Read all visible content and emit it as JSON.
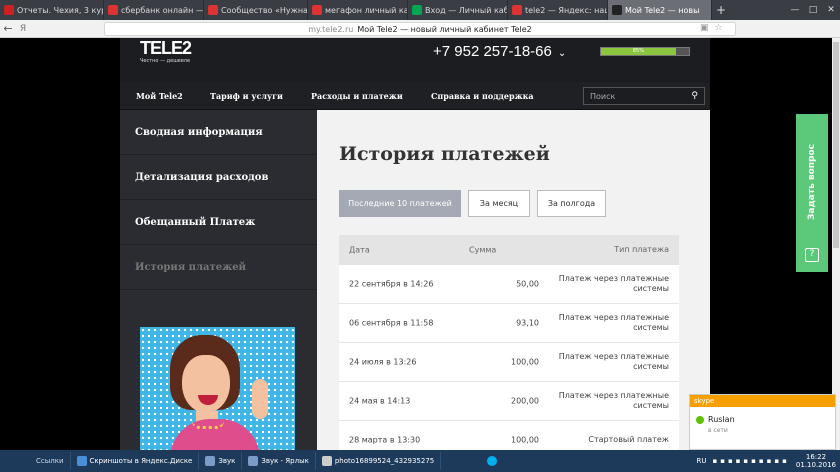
{
  "browser": {
    "tabs": [
      {
        "label": "Отчеты. Чехия, 3 курс",
        "favicon": "opera-icon",
        "color": "#cc2222",
        "active": false
      },
      {
        "label": "сбербанк онлайн — Я",
        "favicon": "yandex-icon",
        "color": "#dd3333",
        "active": false
      },
      {
        "label": "Сообщество «Нужна",
        "favicon": "yandex-icon",
        "color": "#dd3333",
        "active": false
      },
      {
        "label": "мегафон личный кабі",
        "favicon": "yandex-icon",
        "color": "#dd3333",
        "active": false
      },
      {
        "label": "Вход — Личный кабі",
        "favicon": "megafon-icon",
        "color": "#00a651",
        "active": false
      },
      {
        "label": "tele2 — Яндекс: наш",
        "favicon": "yandex-icon",
        "color": "#dd3333",
        "active": false
      },
      {
        "label": "Мой Tele2 — новы",
        "favicon": "tele2-icon",
        "color": "#222222",
        "active": true
      }
    ],
    "new_tab": "+",
    "window_controls": [
      "—",
      "□",
      "✕"
    ],
    "back": "←",
    "yandex_btn": "Я",
    "url_host": "my.tele2.ru",
    "url_title": "Мой Tele2 — новый личный кабинет Tele2"
  },
  "site": {
    "logo_name": "TELE2",
    "logo_slogan": "Честно — дешевле",
    "phone": "+7 952 257-18-66",
    "balance_percent_label": "85%",
    "balance_fill": 0.85,
    "nav": [
      "Мой Tele2",
      "Тариф и услуги",
      "Расходы и платежи",
      "Справка и поддержка"
    ],
    "search_placeholder": "Поиск",
    "sidebar": [
      {
        "label": "Сводная информация",
        "active": false
      },
      {
        "label": "Детализация расходов",
        "active": false
      },
      {
        "label": "Обещанный Платеж",
        "active": false
      },
      {
        "label": "История платежей",
        "active": true
      }
    ],
    "page_title": "История платежей",
    "filters": [
      "Последние 10 платежей",
      "За месяц",
      "За полгода"
    ],
    "table": {
      "headers": {
        "date": "Дата",
        "sum": "Сумма",
        "type": "Тип платежа"
      },
      "rows": [
        {
          "date": "22 сентября в 14:26",
          "sum": "50,00",
          "type": "Платеж через платежные системы"
        },
        {
          "date": "06 сентября в 11:58",
          "sum": "93,10",
          "type": "Платеж через платежные системы"
        },
        {
          "date": "24 июля в 13:26",
          "sum": "100,00",
          "type": "Платеж через платежные системы"
        },
        {
          "date": "24 мая в 14:13",
          "sum": "200,00",
          "type": "Платеж через платежные системы"
        },
        {
          "date": "28 марта в 13:30",
          "sum": "100,00",
          "type": "Стартовый платеж"
        }
      ]
    },
    "ask_question": "Задать вопрос"
  },
  "skype": {
    "title": "skype",
    "contact": "Ruslan",
    "status": "в сети"
  },
  "taskbar": {
    "links": "Ссылки",
    "items": [
      {
        "label": "Скриншоты в Яндекс.Диске",
        "color": "#4a90d9"
      },
      {
        "label": "Звук",
        "color": "#7a9cc6"
      },
      {
        "label": "Звук - Ярлык",
        "color": "#7a9cc6"
      },
      {
        "label": "photo16899524_432935275",
        "color": "#cccccc"
      }
    ],
    "lang": "RU",
    "time": "16:22",
    "date": "01.10.2016"
  }
}
